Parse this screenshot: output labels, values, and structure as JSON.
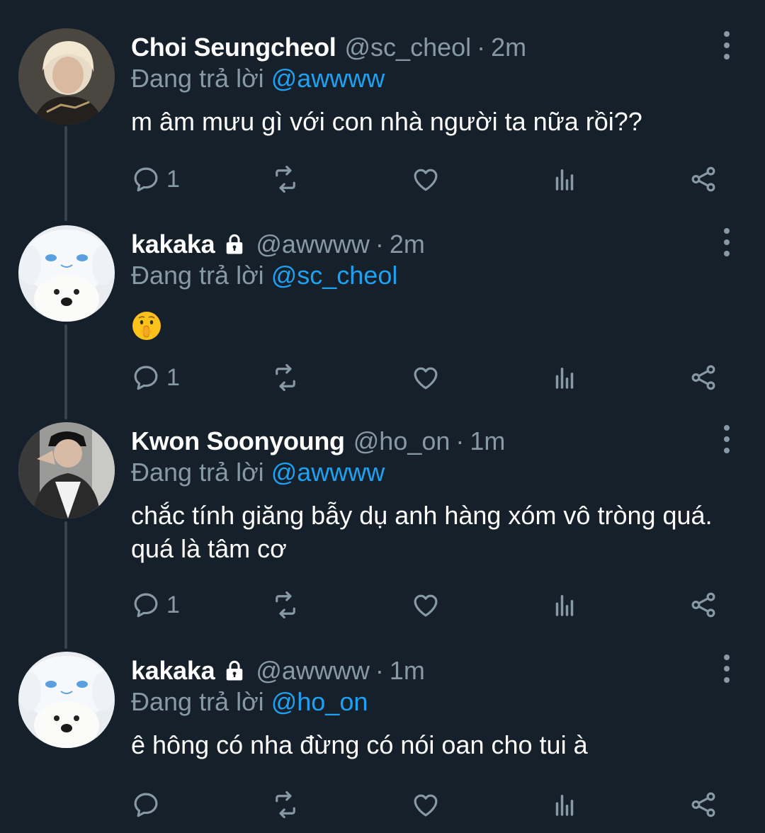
{
  "reply_prefix": "Đang trả lời",
  "colors": {
    "background": "#15202b",
    "muted": "#8899a6",
    "link": "#1da1f2",
    "divider": "#38444d"
  },
  "tweets": [
    {
      "name": "Choi Seungcheol",
      "locked": false,
      "handle": "@sc_cheol",
      "separator": "·",
      "time": "2m",
      "reply_to": "@awwww",
      "text": "m âm mưu gì với con nhà người ta nữa rồi??",
      "reply_count": "1",
      "avatar": "photo-blond-man"
    },
    {
      "name": "kakaka",
      "locked": true,
      "handle": "@awwww",
      "separator": "·",
      "time": "2m",
      "reply_to": "@sc_cheol",
      "text": "",
      "emoji": "shushing-face-emoji",
      "reply_count": "1",
      "avatar": "photo-dog-cinnamoroll-hat"
    },
    {
      "name": "Kwon Soonyoung",
      "locked": false,
      "handle": "@ho_on",
      "separator": "·",
      "time": "1m",
      "reply_to": "@awwww",
      "text": "chắc tính giăng bẫy dụ anh hàng xóm vô tròng quá. quá là tâm cơ",
      "reply_count": "1",
      "avatar": "photo-man-black-cap"
    },
    {
      "name": "kakaka",
      "locked": true,
      "handle": "@awwww",
      "separator": "·",
      "time": "1m",
      "reply_to": "@ho_on",
      "text": "ê hông có nha đừng có nói oan cho tui à",
      "reply_count": "",
      "avatar": "photo-dog-cinnamoroll-hat"
    }
  ]
}
